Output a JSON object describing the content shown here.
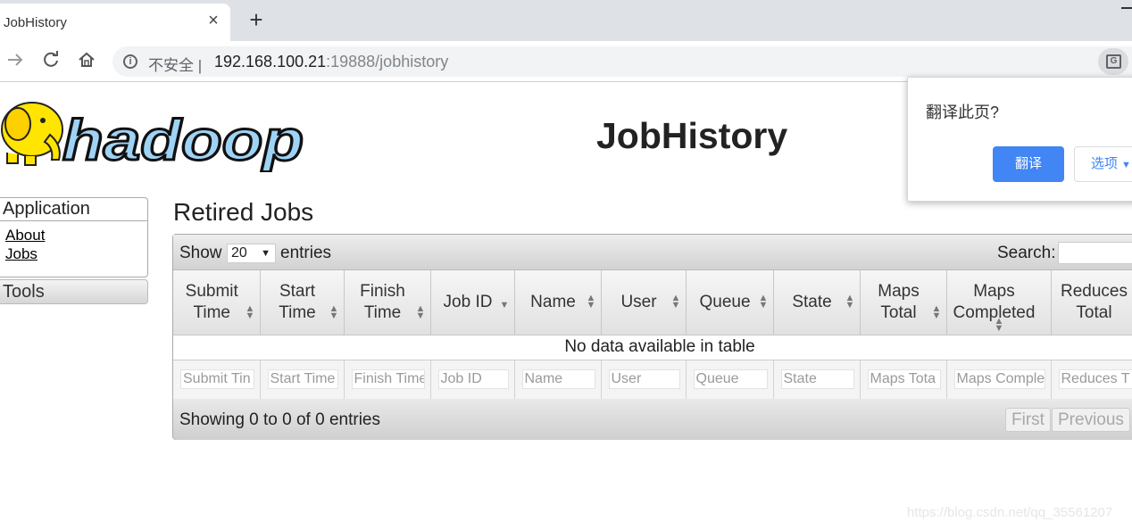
{
  "browser": {
    "tab_title": "JobHistory",
    "tab_close": "×",
    "new_tab": "+",
    "security_label": "不安全",
    "separator": "|",
    "url_host": "192.168.100.21",
    "url_path": ":19888/jobhistory"
  },
  "header": {
    "page_title": "JobHistory",
    "logo_text": "hadoop"
  },
  "sidebar": {
    "application_label": "Application",
    "links": [
      "About",
      "Jobs"
    ],
    "tools_label": "Tools"
  },
  "main": {
    "section_title": "Retired Jobs",
    "show_label": "Show",
    "page_length": "20",
    "entries_label": "entries",
    "search_label": "Search:",
    "columns": [
      "Submit Time",
      "Start Time",
      "Finish Time",
      "Job ID",
      "Name",
      "User",
      "Queue",
      "State",
      "Maps Total",
      "Maps Completed",
      "Reduces Total"
    ],
    "empty_message": "No data available in table",
    "filter_placeholders": [
      "Submit Tin",
      "Start Time",
      "Finish Time",
      "Job ID",
      "Name",
      "User",
      "Queue",
      "State",
      "Maps Tota",
      "Maps Comple",
      "Reduces T"
    ],
    "info_text": "Showing 0 to 0 of 0 entries",
    "pager": {
      "first": "First",
      "previous": "Previous"
    }
  },
  "translate_popup": {
    "question": "翻译此页?",
    "translate_button": "翻译",
    "options_button": "选项"
  },
  "watermark": "https://blog.csdn.net/qq_35561207",
  "colors": {
    "translate_blue": "#4285f4",
    "logo_yellow": "#ffe500",
    "logo_blue": "#9ed3f5"
  }
}
